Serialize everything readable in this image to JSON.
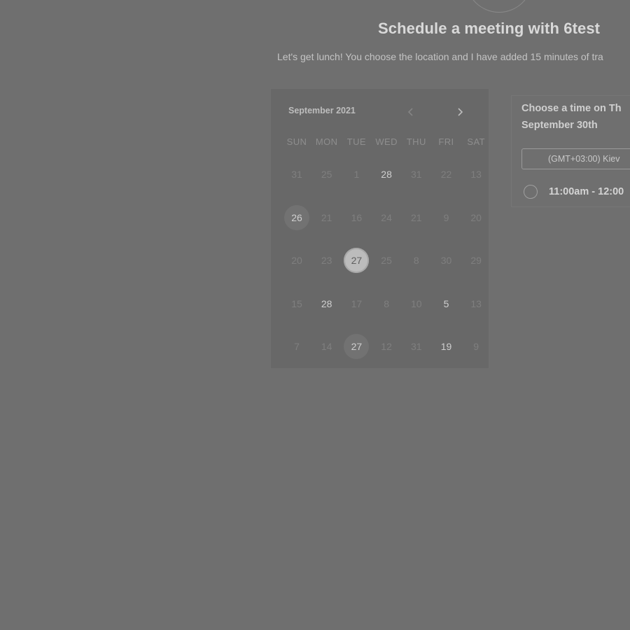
{
  "header": {
    "title": "Schedule a meeting with 6test",
    "subtitle": "Let's get lunch! You choose the location and I have added 15 minutes of tra"
  },
  "calendar": {
    "month_label": "September 2021",
    "prev_icon": "chevron-left-icon",
    "next_icon": "chevron-right-icon",
    "weekdays": [
      "SUN",
      "MON",
      "TUE",
      "WED",
      "THU",
      "FRI",
      "SAT"
    ],
    "weeks": [
      [
        {
          "label": "31",
          "state": "disabled"
        },
        {
          "label": "25",
          "state": "disabled"
        },
        {
          "label": "1",
          "state": "disabled"
        },
        {
          "label": "28",
          "state": "available"
        },
        {
          "label": "31",
          "state": "disabled"
        },
        {
          "label": "22",
          "state": "disabled"
        },
        {
          "label": "13",
          "state": "disabled"
        }
      ],
      [
        {
          "label": "26",
          "state": "highlighted"
        },
        {
          "label": "21",
          "state": "disabled"
        },
        {
          "label": "16",
          "state": "disabled"
        },
        {
          "label": "24",
          "state": "disabled"
        },
        {
          "label": "21",
          "state": "disabled"
        },
        {
          "label": "9",
          "state": "disabled"
        },
        {
          "label": "20",
          "state": "disabled"
        }
      ],
      [
        {
          "label": "20",
          "state": "disabled"
        },
        {
          "label": "23",
          "state": "disabled"
        },
        {
          "label": "27",
          "state": "selected"
        },
        {
          "label": "25",
          "state": "disabled"
        },
        {
          "label": "8",
          "state": "disabled"
        },
        {
          "label": "30",
          "state": "disabled"
        },
        {
          "label": "29",
          "state": "disabled"
        }
      ],
      [
        {
          "label": "15",
          "state": "disabled"
        },
        {
          "label": "28",
          "state": "available"
        },
        {
          "label": "17",
          "state": "disabled"
        },
        {
          "label": "8",
          "state": "disabled"
        },
        {
          "label": "10",
          "state": "disabled"
        },
        {
          "label": "5",
          "state": "available"
        },
        {
          "label": "13",
          "state": "disabled"
        }
      ],
      [
        {
          "label": "7",
          "state": "disabled"
        },
        {
          "label": "14",
          "state": "disabled"
        },
        {
          "label": "27",
          "state": "highlighted"
        },
        {
          "label": "12",
          "state": "disabled"
        },
        {
          "label": "31",
          "state": "disabled"
        },
        {
          "label": "19",
          "state": "available"
        },
        {
          "label": "9",
          "state": "disabled"
        }
      ]
    ]
  },
  "times": {
    "heading_line1": "Choose a time on Th",
    "heading_line2": "September 30th",
    "timezone": "(GMT+03:00) Kiev",
    "slots": [
      {
        "label": "11:00am - 12:00"
      }
    ]
  }
}
